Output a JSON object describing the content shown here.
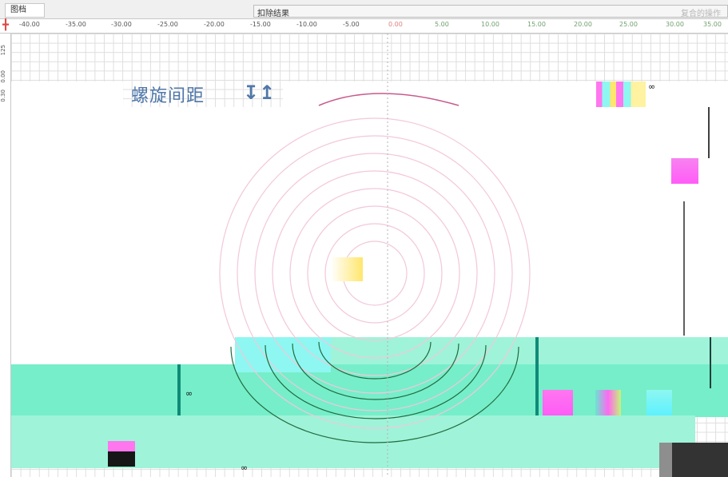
{
  "header": {
    "tab_label": "图档",
    "result_label": "扣除结果",
    "result_hint": "复合的操作"
  },
  "ruler": {
    "h_ticks": [
      "-40.00",
      "-35.00",
      "-30.00",
      "-25.00",
      "-20.00",
      "-15.00",
      "-10.00",
      "-5.00",
      "0.00",
      "5.00",
      "10.00",
      "15.00",
      "20.00",
      "25.00",
      "30.00",
      "35.00"
    ],
    "v_ticks": [
      "125",
      "0.00",
      "0.30"
    ]
  },
  "canvas": {
    "title": "螺旋间距",
    "symbol": "∞"
  },
  "colors": {
    "spiral_pink": "#f0a8c8",
    "spiral_green": "#208040",
    "accent_blue": "#4f77a9",
    "mint": "#9ff3d8"
  }
}
